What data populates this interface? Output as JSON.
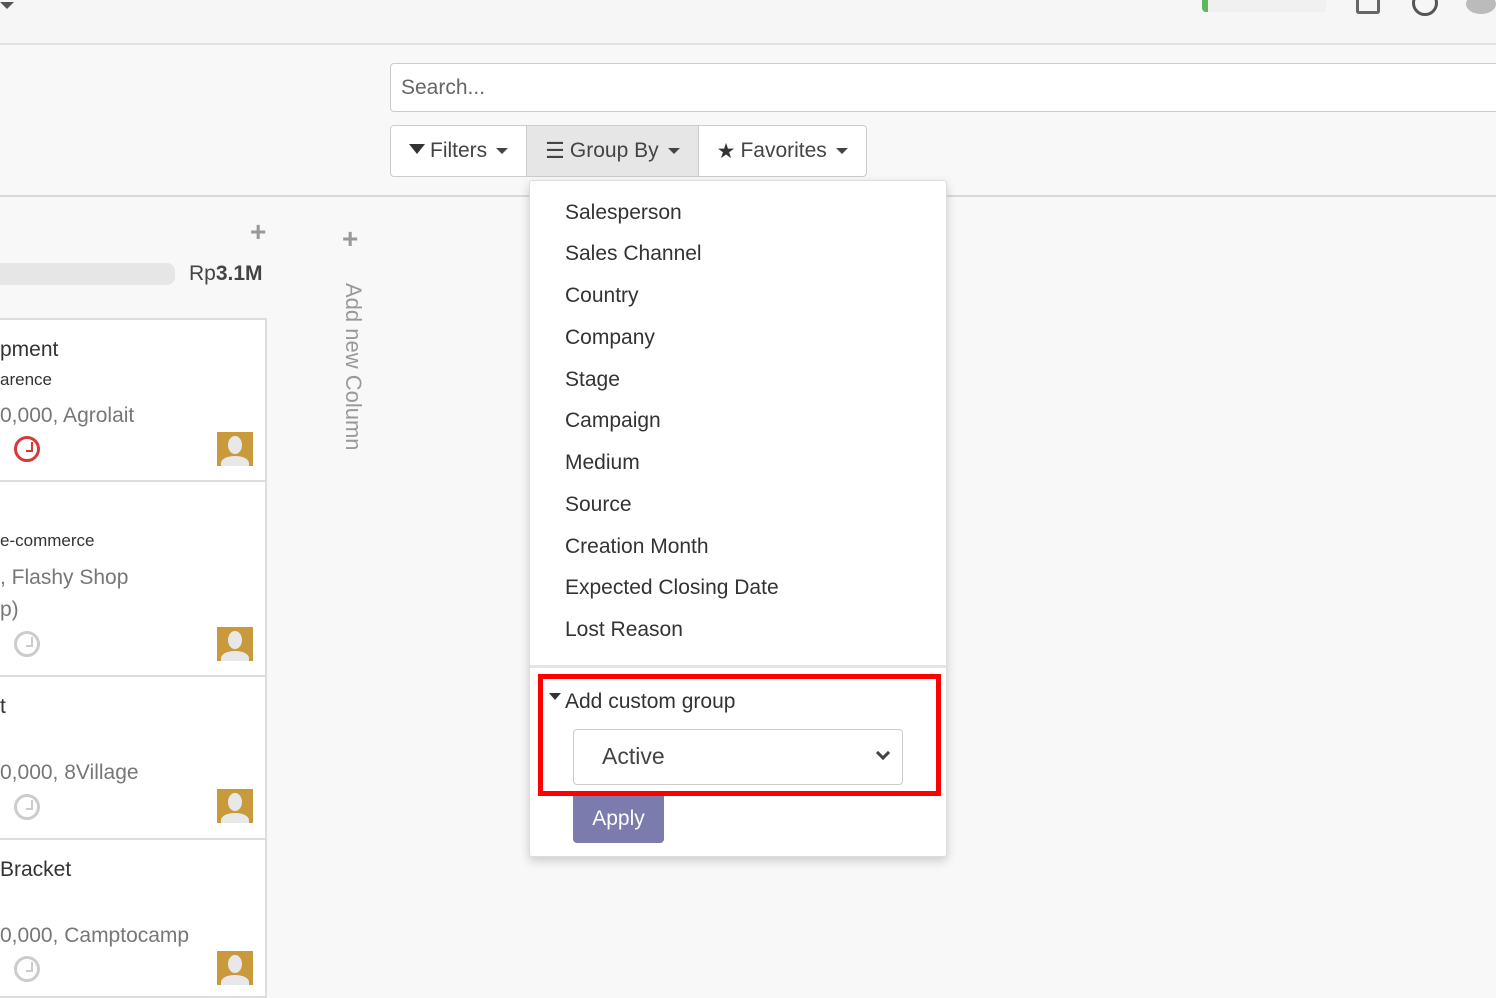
{
  "search": {
    "placeholder": "Search..."
  },
  "toolbar": {
    "filters": "Filters",
    "group_by": "Group By",
    "favorites": "Favorites"
  },
  "group_by_menu": {
    "items": [
      "Salesperson",
      "Sales Channel",
      "Country",
      "Company",
      "Stage",
      "Campaign",
      "Medium",
      "Source",
      "Creation Month",
      "Expected Closing Date",
      "Lost Reason"
    ],
    "custom_group_label": "Add custom group",
    "custom_group_selected": "Active",
    "apply_label": "Apply"
  },
  "kanban": {
    "column_total_prefix": "Rp",
    "column_total": "3.1M",
    "add_column_label": "Add new Column",
    "cards": [
      {
        "title": "pment",
        "subtitle": "arence",
        "info": "0,000, Agrolait",
        "overdue": true
      },
      {
        "title": "",
        "subtitle": "e-commerce",
        "info": ", Flashy Shop",
        "info2": "p)",
        "overdue": false
      },
      {
        "title": "t",
        "subtitle": "",
        "info": "0,000, 8Village",
        "overdue": false
      },
      {
        "title": "Bracket",
        "subtitle": "",
        "info": "0,000, Camptocamp",
        "overdue": false
      }
    ]
  },
  "colors": {
    "apply_button": "#7c7bad",
    "highlight": "#ff0000",
    "overdue": "#d9383a",
    "avatar": "#c99a3b"
  }
}
